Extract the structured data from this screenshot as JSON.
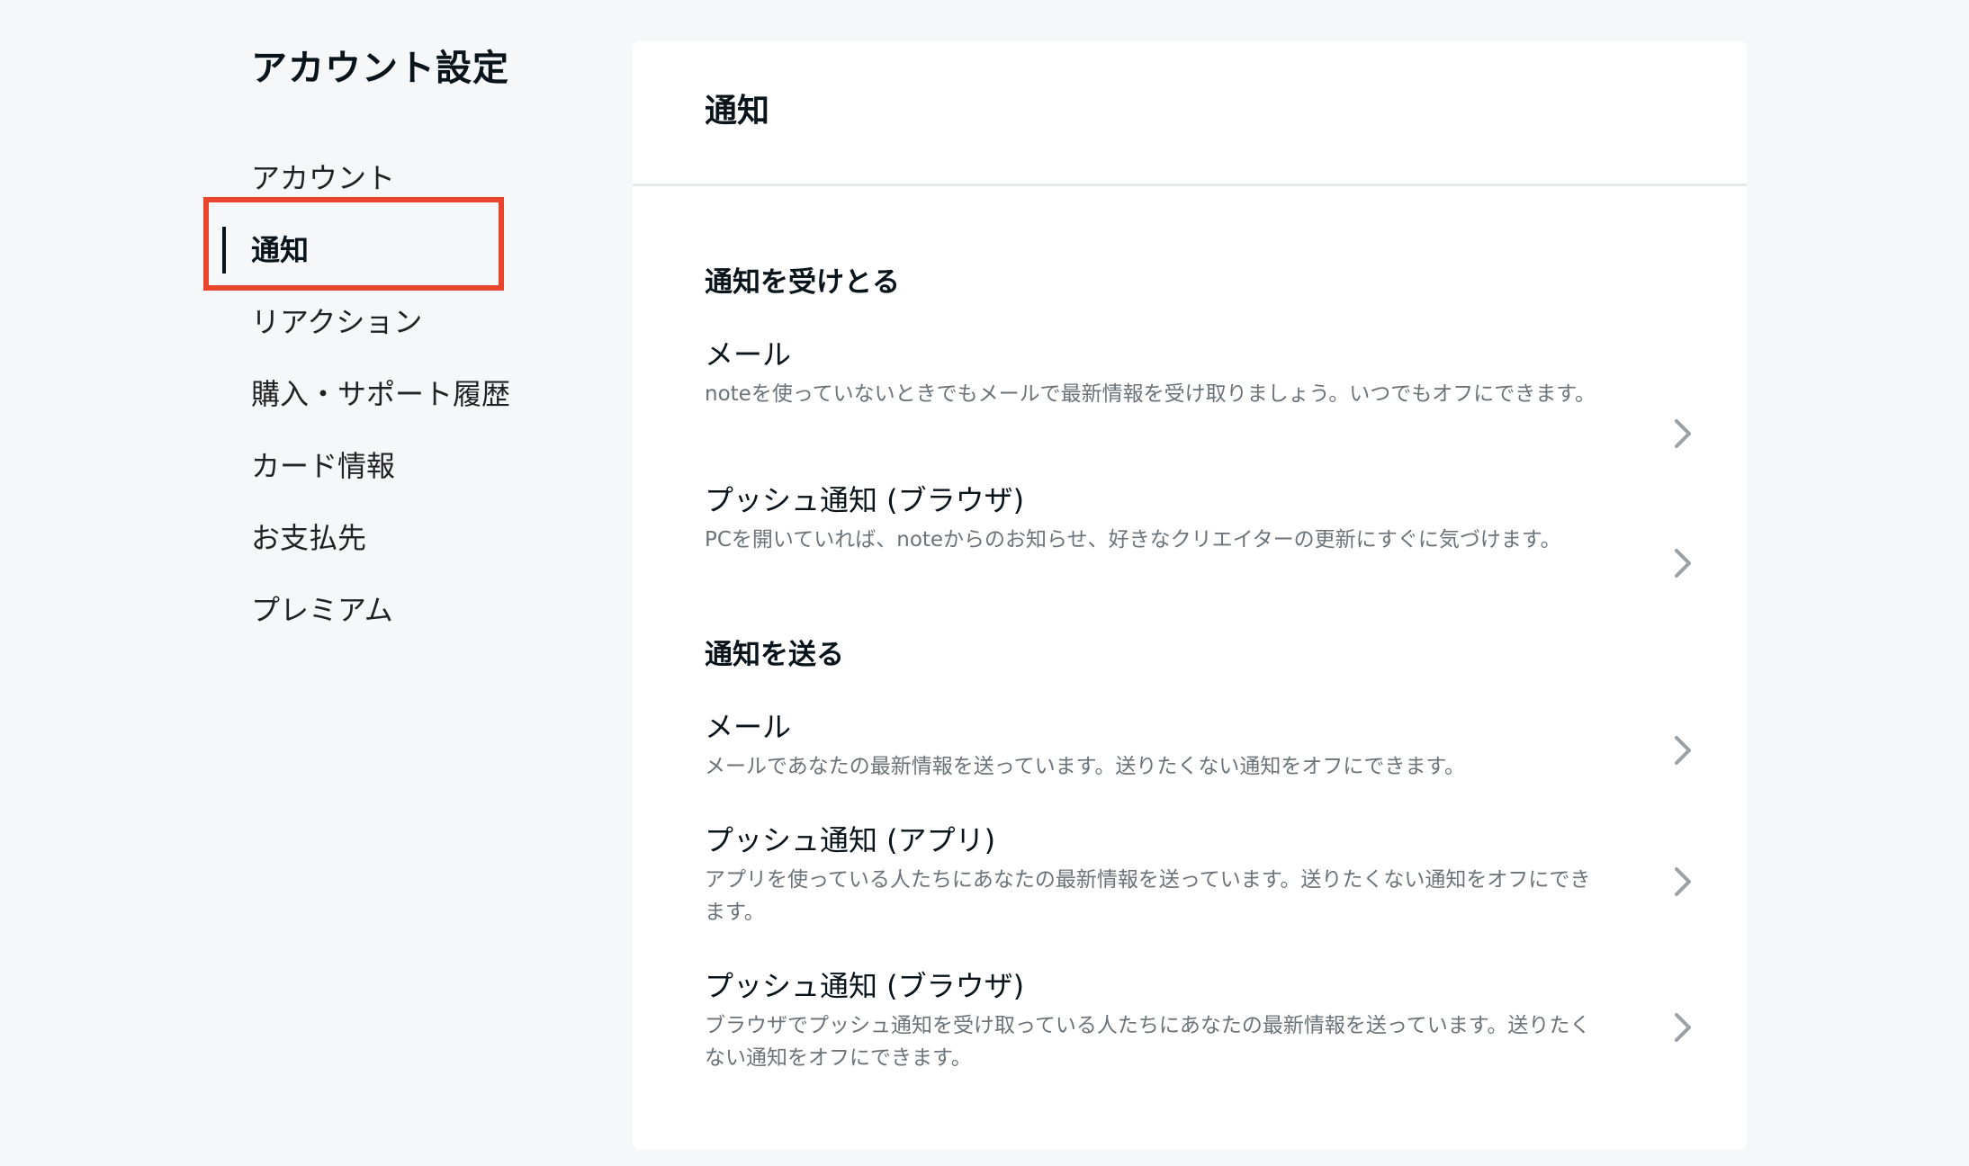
{
  "sidebar": {
    "title": "アカウント設定",
    "items": [
      {
        "label": "アカウント"
      },
      {
        "label": "通知"
      },
      {
        "label": "リアクション"
      },
      {
        "label": "購入・サポート履歴"
      },
      {
        "label": "カード情報"
      },
      {
        "label": "お支払先"
      },
      {
        "label": "プレミアム"
      }
    ],
    "active_index": 1
  },
  "main": {
    "title": "通知",
    "receive": {
      "heading": "通知を受けとる",
      "items": [
        {
          "title": "メール",
          "desc": "noteを使っていないときでもメールで最新情報を受け取りましょう。いつでもオフにできます。"
        },
        {
          "title": "プッシュ通知 (ブラウザ)",
          "desc": "PCを開いていれば、noteからのお知らせ、好きなクリエイターの更新にすぐに気づけます。"
        }
      ]
    },
    "send": {
      "heading": "通知を送る",
      "items": [
        {
          "title": "メール",
          "desc": "メールであなたの最新情報を送っています。送りたくない通知をオフにできます。"
        },
        {
          "title": "プッシュ通知 (アプリ)",
          "desc": "アプリを使っている人たちにあなたの最新情報を送っています。送りたくない通知をオフにできます。"
        },
        {
          "title": "プッシュ通知 (ブラウザ)",
          "desc": "ブラウザでプッシュ通知を受け取っている人たちにあなたの最新情報を送っています。送りたくない通知をオフにできます。"
        }
      ]
    }
  },
  "colors": {
    "background": "#f6f7f8",
    "card": "#ffffff",
    "text": "#08131a",
    "muted": "#6b7378",
    "highlight": "#e8452c"
  },
  "icons": {
    "row_chevron": "chevron-right-icon"
  }
}
